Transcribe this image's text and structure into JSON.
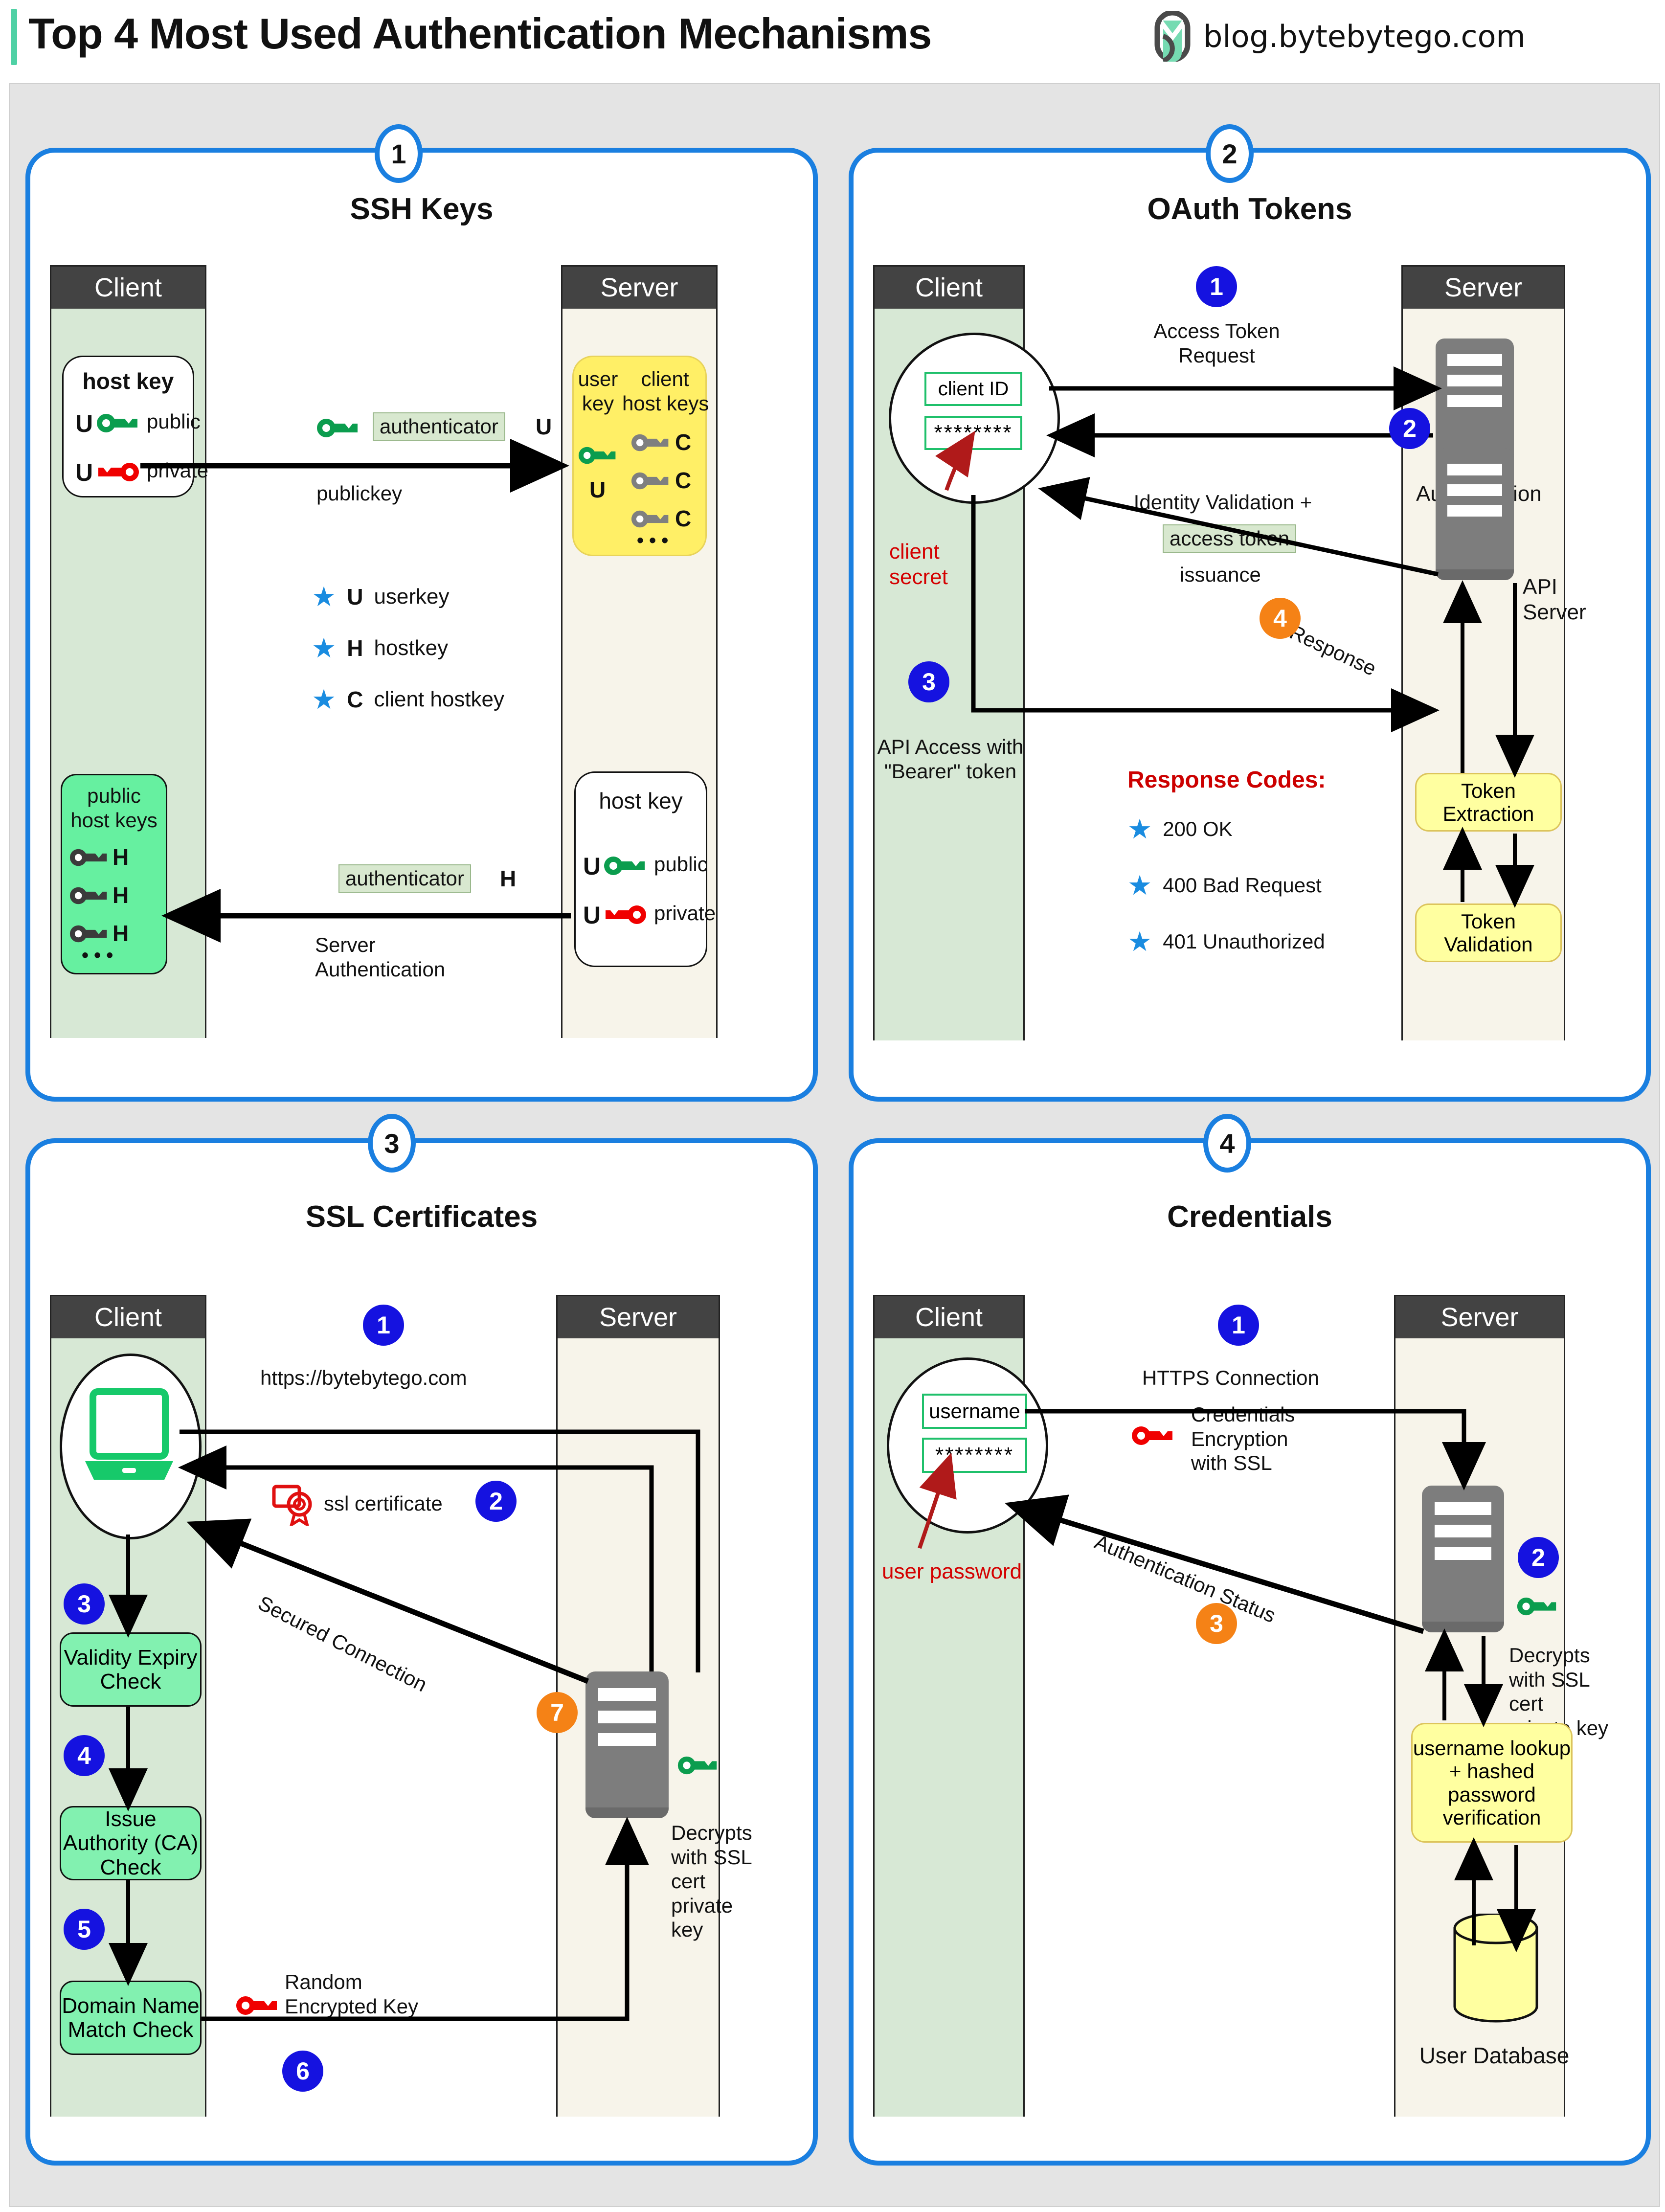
{
  "header": {
    "title": "Top 4 Most Used Authentication Mechanisms",
    "brand": "blog.bytebytego.com",
    "accent_color": "#4fd1a5",
    "panel_border_color": "#1a7fe0"
  },
  "panels": [
    {
      "number": "1",
      "title": "SSH Keys",
      "client_header": "Client",
      "server_header": "Server",
      "client_hostkey_title": "host key",
      "client_public_tag": "U",
      "client_public_label": "public",
      "client_private_tag": "U",
      "client_private_label": "private",
      "authenticator_top": "authenticator",
      "authenticator_top_tag": "U",
      "publickey_label": "publickey",
      "server_userkey_title": "user\nkey",
      "server_userkey_tag": "U",
      "server_clienthostkeys_title": "client\nhost keys",
      "server_client_key_tags": [
        "C",
        "C",
        "C"
      ],
      "server_ellipsis": "• • •",
      "legend": [
        {
          "tag": "U",
          "text": "userkey"
        },
        {
          "tag": "H",
          "text": "hostkey"
        },
        {
          "tag": "C",
          "text": "client hostkey"
        }
      ],
      "client_pubhostkeys_title": "public\nhost keys",
      "client_host_key_tags": [
        "H",
        "H",
        "H"
      ],
      "client_ellipsis": "• • •",
      "authenticator_bottom": "authenticator",
      "authenticator_bottom_tag": "H",
      "server_auth_label": "Server\nAuthentication",
      "server_hostkey_title": "host key",
      "server_public_tag": "U",
      "server_public_label": "public",
      "server_private_tag": "U",
      "server_private_label": "private"
    },
    {
      "number": "2",
      "title": "OAuth Tokens",
      "client_header": "Client",
      "server_header": "Server",
      "client_id_field": "client ID",
      "client_secret_field": "********",
      "client_secret_note": "client\nsecret",
      "step1": "1",
      "step1_label": "Access Token\nRequest",
      "step2": "2",
      "step2_label_a": "Identity Validation +",
      "step2_label_hl": "access token",
      "step2_label_b": "issuance",
      "authorization_server": "Authorization\nServer",
      "step3": "3",
      "step3_label": "API Access with\n\"Bearer\" token",
      "step4": "4",
      "step4_label": "Response",
      "api_server": "API\nServer",
      "response_codes_title": "Response Codes:",
      "response_codes": [
        "200 OK",
        "400 Bad Request",
        "401 Unauthorized"
      ],
      "token_extraction": "Token Extraction",
      "token_validation": "Token Validation"
    },
    {
      "number": "3",
      "title": "SSL Certificates",
      "client_header": "Client",
      "server_header": "Server",
      "step1": "1",
      "step1_label": "https://bytebytego.com",
      "step2": "2",
      "step2_label": "ssl certificate",
      "step3": "3",
      "box3": "Validity Expiry\nCheck",
      "step4": "4",
      "box4": "Issue Authority\n(CA) Check",
      "step5": "5",
      "box5": "Domain Name\nMatch Check",
      "step6": "6",
      "step6_label": "Random\nEncrypted Key",
      "step7": "7",
      "secured_connection": "Secured Connection",
      "decrypts_label": "Decrypts\nwith SSL\ncert\nprivate\nkey"
    },
    {
      "number": "4",
      "title": "Credentials",
      "client_header": "Client",
      "server_header": "Server",
      "username_field": "username",
      "password_field": "********",
      "password_note": "user password",
      "step1": "1",
      "step1_label": "HTTPS Connection",
      "credentials_encryption": "Credentials\nEncryption\nwith SSL",
      "step2": "2",
      "decrypts_label": "Decrypts\nwith SSL\ncert\nprivate key",
      "step3": "3",
      "auth_status": "Authentication Status",
      "lookup_box": "username lookup\n+\nhashed password\nverification",
      "user_database": "User Database"
    }
  ],
  "colors": {
    "client_fill": "#d7e8d5",
    "server_fill": "#f7f4ea",
    "header_fill": "#434343",
    "key_green": "#0b9d4e",
    "key_red": "#f00000",
    "key_gray": "#7f7f7f",
    "key_dark": "#3b3b3b",
    "badge_blue": "#1512e0",
    "badge_orange": "#f58216",
    "star_blue": "#1a8ce0",
    "yellow": "#ffff99",
    "green_box": "#82f1b0"
  }
}
